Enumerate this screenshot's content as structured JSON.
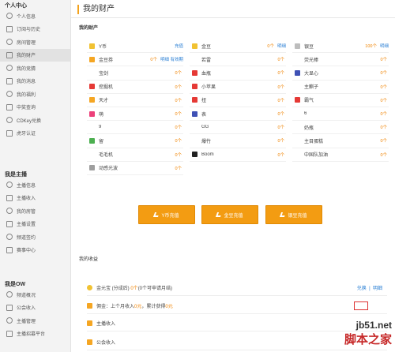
{
  "sidebar": {
    "sections": [
      {
        "title": "个人中心",
        "items": [
          "个人信息",
          "订阅与历史",
          "房间管理",
          "我的财产",
          "我的竞猜",
          "我的消息",
          "我的福利",
          "中奖查询",
          "CDKey兑换",
          "虎牙认证"
        ]
      },
      {
        "title": "我是主播",
        "items": [
          "主播信息",
          "主播收入",
          "我的房管",
          "主播设置",
          "频道签约",
          "赛事中心"
        ]
      },
      {
        "title": "我是OW",
        "items": [
          "频道概况",
          "公会收入",
          "主播管理",
          "主播招募平台"
        ]
      }
    ],
    "active_item": "我的财产"
  },
  "main": {
    "title": "我的财产",
    "section_assets": "我的财产",
    "section_income": "我的收益",
    "columns": [
      [
        {
          "name": "Y币",
          "link": "充值",
          "color": "#f1c232"
        },
        {
          "name": "金豆券",
          "count": "0个",
          "link": "明细 有效期",
          "color": "#f5a623"
        },
        {
          "name": "宝剑",
          "count": "0个",
          "color": ""
        },
        {
          "name": "挖掘机",
          "count": "0个",
          "color": "#e53935"
        },
        {
          "name": "天才",
          "count": "0个",
          "color": "#f5a623"
        },
        {
          "name": "萌",
          "count": "0个",
          "color": "#ec407a"
        },
        {
          "name": "9",
          "count": "0个",
          "color": ""
        },
        {
          "name": "留",
          "count": "0个",
          "color": "#4caf50"
        },
        {
          "name": "毛毛机",
          "count": "0个",
          "color": ""
        },
        {
          "name": "动感光波",
          "count": "0个",
          "color": "#9e9e9e"
        }
      ],
      [
        {
          "name": "金豆",
          "count": "0个",
          "link": "明细",
          "color": "#f1c232"
        },
        {
          "name": "若雷",
          "count": "0个",
          "color": ""
        },
        {
          "name": "血瓶",
          "count": "0个",
          "color": "#e53935"
        },
        {
          "name": "小苹果",
          "count": "0个",
          "color": "#e53935"
        },
        {
          "name": "扭",
          "count": "0个",
          "color": "#e53935"
        },
        {
          "name": "表",
          "count": "0个",
          "color": "#3f51b5"
        },
        {
          "name": "GG",
          "count": "0个",
          "color": ""
        },
        {
          "name": "爆竹",
          "count": "0个",
          "color": ""
        },
        {
          "name": "Boom",
          "count": "0个",
          "color": "#212121"
        }
      ],
      [
        {
          "name": "银豆",
          "count": "100个",
          "link": "明细",
          "color": "#bdbdbd"
        },
        {
          "name": "荧光棒",
          "count": "0个",
          "color": ""
        },
        {
          "name": "大显心",
          "count": "0个",
          "color": "#3f51b5"
        },
        {
          "name": "主麒子",
          "count": "0个",
          "color": ""
        },
        {
          "name": "霸气",
          "count": "0个",
          "color": "#e53935"
        },
        {
          "name": "6",
          "count": "0个",
          "color": ""
        },
        {
          "name": "奶瓶",
          "count": "0个",
          "color": ""
        },
        {
          "name": "主目蛋糕",
          "count": "0个",
          "color": ""
        },
        {
          "name": "中国队加油",
          "count": "0个",
          "color": ""
        }
      ]
    ],
    "buttons": [
      "Y币充值",
      "金豆充值",
      "银豆充值"
    ],
    "income": [
      {
        "label": "金元宝 (分成后)",
        "amount": "0个",
        "note": "(0个可申请月结)",
        "links": [
          "兑换",
          "明细"
        ]
      },
      {
        "label": "佣金：上个月收入",
        "amount": "0元",
        "note": "，累计获得",
        "amount2": "0元"
      },
      {
        "label": "主播收入"
      },
      {
        "label": "公会收入"
      }
    ],
    "watermark": {
      "line1": "jb51.net",
      "line2": "脚本之家"
    }
  }
}
